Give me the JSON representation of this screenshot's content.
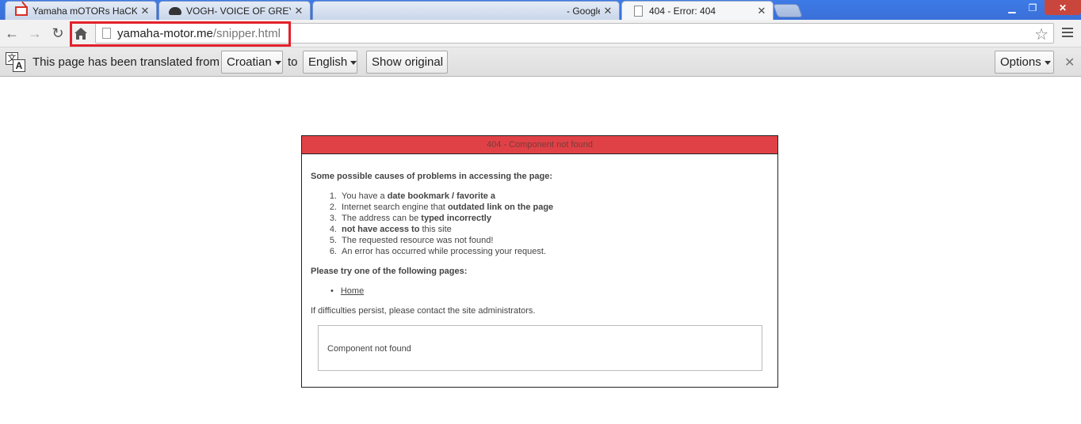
{
  "tabs": [
    {
      "title": "Yamaha mOTORs HaCKE",
      "icon": "gmail-icon"
    },
    {
      "title": "VOGH- VOICE OF GREYHA",
      "icon": "hat-icon"
    },
    {
      "title": "- Google S",
      "icon": "blank-icon"
    },
    {
      "title": "404 - Error: 404",
      "icon": "page-icon",
      "active": true
    }
  ],
  "toolbar": {
    "url_host": "yamaha-motor.me",
    "url_path": "/snipper.html"
  },
  "translate_bar": {
    "message": "This page has been translated from",
    "from_language": "Croatian",
    "connector": "to",
    "to_language": "English",
    "show_original": "Show original",
    "options": "Options"
  },
  "error": {
    "header": "404 - Component not found",
    "causes_heading": "Some possible causes of problems in accessing the page:",
    "causes": [
      {
        "num": "1.",
        "pre": "You have a ",
        "bold": "date bookmark / favorite a",
        "post": ""
      },
      {
        "num": "2.",
        "pre": "Internet search engine that ",
        "bold": "outdated link on the page",
        "post": ""
      },
      {
        "num": "3.",
        "pre": "The address can be ",
        "bold": "typed incorrectly",
        "post": ""
      },
      {
        "num": "4.",
        "pre": "",
        "bold": "not have access to",
        "post": " this site"
      },
      {
        "num": "5.",
        "pre": "The requested resource was not found!",
        "bold": "",
        "post": ""
      },
      {
        "num": "6.",
        "pre": "An error has occurred while processing your request.",
        "bold": "",
        "post": ""
      }
    ],
    "try_heading": "Please try one of the following pages:",
    "home_link": "Home",
    "persist_text": "If difficulties persist, please contact the site administrators.",
    "inner_message": "Component not found"
  },
  "colors": {
    "tabstrip": "#3a6fd8",
    "error_header": "#e04146",
    "highlight": "#e4212b"
  }
}
